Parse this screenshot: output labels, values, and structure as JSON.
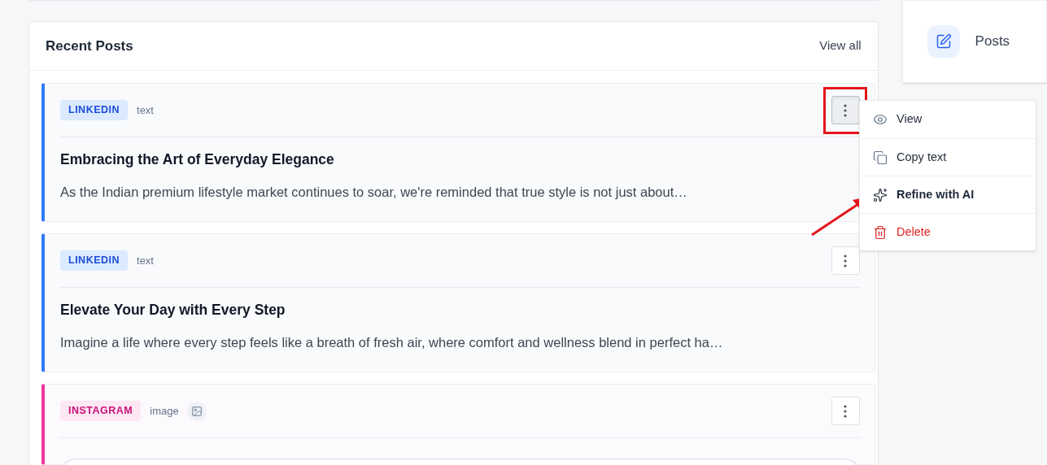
{
  "recent_posts": {
    "title": "Recent Posts",
    "view_all": "View all",
    "posts": [
      {
        "platform": "LINKEDIN",
        "kind": "linkedin",
        "type": "text",
        "has_image": false,
        "title": "Embracing the Art of Everyday Elegance",
        "excerpt": "As the Indian premium lifestyle market continues to soar, we're reminded that true style is not just about…",
        "menu_open": true,
        "highlighted": true
      },
      {
        "platform": "LINKEDIN",
        "kind": "linkedin",
        "type": "text",
        "has_image": false,
        "title": "Elevate Your Day with Every Step",
        "excerpt": "Imagine a life where every step feels like a breath of fresh air, where comfort and wellness blend in perfect ha…",
        "menu_open": false,
        "highlighted": false
      },
      {
        "platform": "INSTAGRAM",
        "kind": "instagram",
        "type": "image",
        "has_image": true,
        "menu_open": false,
        "highlighted": false
      }
    ]
  },
  "menu": {
    "items": [
      {
        "label": "View",
        "kind": "view"
      },
      {
        "label": "Copy text",
        "kind": "copy"
      },
      {
        "label": "Refine with AI",
        "kind": "ai"
      },
      {
        "label": "Delete",
        "kind": "delete"
      }
    ]
  },
  "sidebar": {
    "items": [
      {
        "label": "Posts",
        "kind": "posts"
      }
    ]
  }
}
